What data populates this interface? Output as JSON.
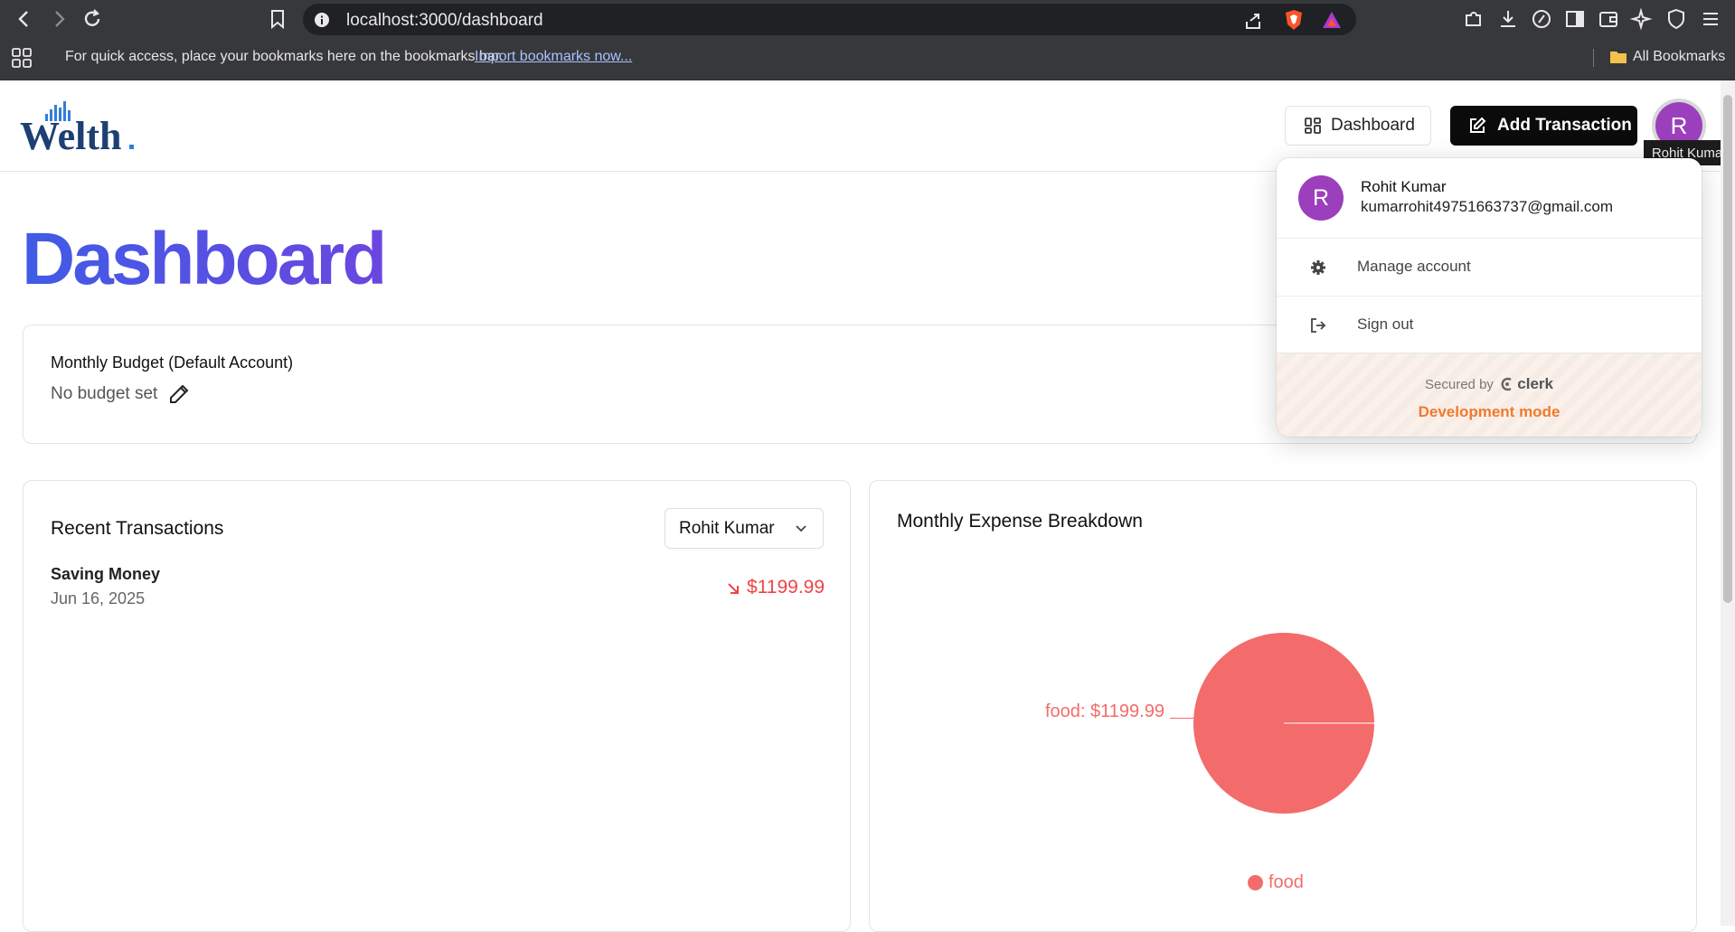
{
  "browser": {
    "url": "localhost:3000/dashboard",
    "bookmarks_bar_text": "For quick access, place your bookmarks here on the bookmarks bar.",
    "bookmarks_link": "Import bookmarks now...",
    "all_bookmarks": "All Bookmarks"
  },
  "header": {
    "logo": "Welth",
    "dashboard_button": "Dashboard",
    "add_transaction_button": "Add Transaction",
    "avatar_initial": "R",
    "tooltip": "Rohit Kumar"
  },
  "page": {
    "title": "Dashboard"
  },
  "budget": {
    "title": "Monthly Budget (Default Account)",
    "value": "No budget set"
  },
  "transactions": {
    "title": "Recent Transactions",
    "account_select": "Rohit Kumar",
    "items": [
      {
        "name": "Saving Money",
        "date": "Jun 16, 2025",
        "amount": "$1199.99",
        "type": "expense"
      }
    ]
  },
  "expenses": {
    "title": "Monthly Expense Breakdown",
    "slice_label": "food: $1199.99",
    "legend": "food"
  },
  "chart_data": {
    "type": "pie",
    "title": "Monthly Expense Breakdown",
    "categories": [
      "food"
    ],
    "values": [
      1199.99
    ],
    "colors": [
      "#f46b6b"
    ],
    "legend_placement": "bottom"
  },
  "user_menu": {
    "avatar_initial": "R",
    "name": "Rohit Kumar",
    "email": "kumarrohit49751663737@gmail.com",
    "manage_account": "Manage account",
    "sign_out": "Sign out",
    "secured_by": "Secured by",
    "clerk": "clerk",
    "dev_mode": "Development mode"
  }
}
